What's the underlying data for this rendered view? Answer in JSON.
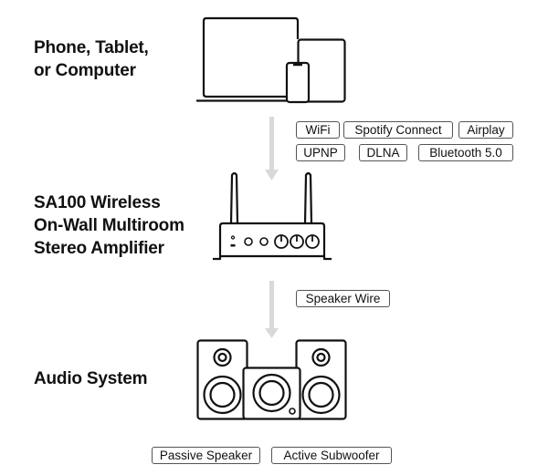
{
  "stages": [
    {
      "label_lines": [
        "Phone, Tablet,",
        "or Computer"
      ],
      "icon": "devices-icon"
    },
    {
      "label_lines": [
        "SA100 Wireless",
        "On-Wall Multiroom",
        "Stereo Amplifier"
      ],
      "icon": "amplifier-icon"
    },
    {
      "label_lines": [
        "Audio System"
      ],
      "icon": "speakers-icon"
    }
  ],
  "connections": {
    "devices_to_amplifier": {
      "row1": [
        "WiFi",
        "Spotify Connect",
        "Airplay"
      ],
      "row2": [
        "UPNP",
        "DLNA",
        "Bluetooth 5.0"
      ]
    },
    "amplifier_to_speakers": [
      "Speaker Wire"
    ]
  },
  "speaker_tags": [
    "Passive Speaker",
    "Active Subwoofer"
  ],
  "colors": {
    "arrow": "#d9d9d9",
    "stroke": "#111111",
    "tag_border": "#555555"
  }
}
